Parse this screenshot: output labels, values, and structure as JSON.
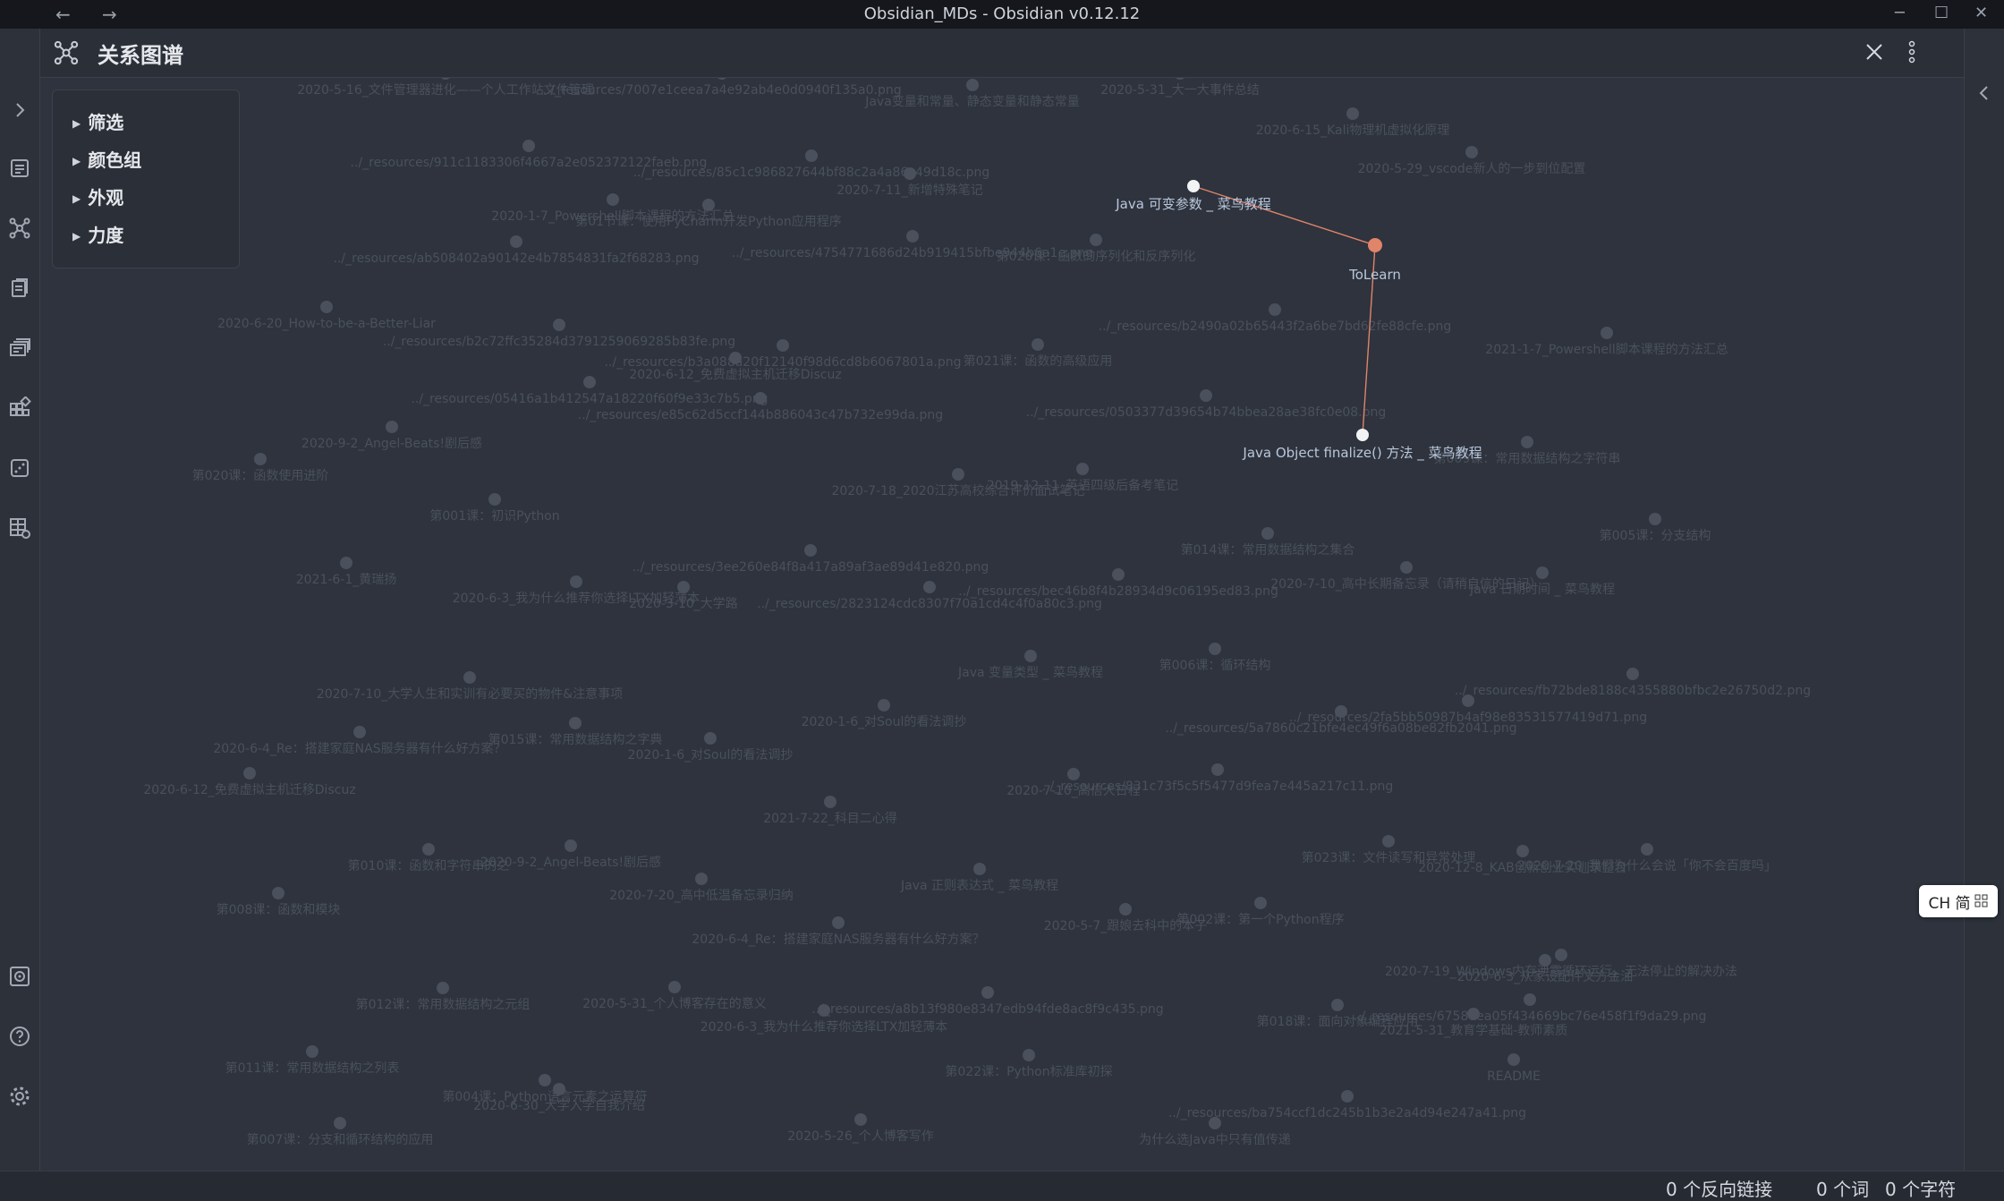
{
  "window": {
    "title": "Obsidian_MDs - Obsidian v0.12.12",
    "back": "←",
    "forward": "→",
    "minimize": "─",
    "maximize": "☐",
    "close": "✕"
  },
  "header": {
    "title": "关系图谱"
  },
  "panel": {
    "items": [
      "筛选",
      "颜色组",
      "外观",
      "力度"
    ]
  },
  "graph": {
    "highlighted": [
      {
        "label": "Java 可变参数 _ 菜鸟教程",
        "kind": "note"
      },
      {
        "label": "ToLearn",
        "kind": "hub"
      },
      {
        "label": "Java Object finalize() 方法 _ 菜鸟教程",
        "kind": "note"
      }
    ],
    "faded_nodes": [
      "2020-5-16_文件管理器进化——个人工作站文件管理",
      "../_resources/7007e1ceea7a4e92ab4e0d0940f135a0.png",
      "Java变量和常量、静态变量和静态常量",
      "2020-5-31_大一大事件总结",
      "2020-6-15_Kali物理机虚拟化原理",
      "2020-5-29_vscode新人的一步到位配置",
      "../_resources/911c1183306f4667a2e052372122faeb.png",
      "../_resources/85c1c986827644bf88c2a4a86c49d18c.png",
      "2020-7-11_新增特殊笔记",
      "2020-1-7_Powershell脚本课程的方法汇总",
      "第01节课：使用PyCharm开发Python应用程序",
      "../_resources/ab508402a90142e4b7854831fa2f68283.png",
      "../_resources/4754771686d24b919415bfbe944b6a1e.png",
      "第020课：函数的序列化和反序列化",
      "2020-6-20_How-to-be-a-Better-Liar",
      "../_resources/b2c72ffc35284d3791259069285b83fe.png",
      "../_resources/b3a088a20f12140f98d6cd8b6067801a.png",
      "2020-6-12_免费虚拟主机迁移Discuz",
      "第021课：函数的高级应用",
      "../_resources/b2490a02b65443f2a6be7bd62fe88cfe.png",
      "2021-1-7_Powershell脚本课程的方法汇总",
      "../_resources/05416a1b412547a18220f60f9e33c7b5.png",
      "../_resources/e85c62d5ccf144b886043c47b732e99da.png",
      "../_resources/0503377d39654b74bbea28ae38fc0e08.png",
      "2020-9-2_Angel-Beats!剧后感",
      "第020课：函数使用进阶",
      "2020-7-18_2020江苏高校综合评价面试笔记",
      "2019-12-11_英语四级后备考笔记",
      "第009课：常用数据结构之字符串",
      "第001课：初识Python",
      "第005课：分支结构",
      "第014课：常用数据结构之集合",
      "../_resources/3ee260e84f8a417a89af3ae89d41e820.png",
      "2020-7-10_高中长期备忘录（请稍自信的日记）",
      "Java 日期时间 _ 菜鸟教程",
      "2021-6-1_黄瑞扬",
      "2020-6-3_我为什么推荐你选择LTX加轻薄本",
      "2020-3-10_大学路",
      "../_resources/2823124cdc8307f70a1cd4c4f0a80c3.png",
      "../_resources/bec46b8f4b28934d9c06195ed83.png",
      "Java 变量类型 _ 菜鸟教程",
      "第006课：循环结构",
      "../_resources/fb72bde8188c4355880bfbc2e26750d2.png",
      "2020-7-10_大学人生和实训有必要买的物件&注意事项",
      "2020-1-6_对Soul的看法调抄",
      "../_resources/5a7860c21bfe4ec49f6a08be82fb2041.png",
      "../_resources/2fa5bb50987b4af98e83531577419d71.png",
      "2020-6-4_Re：搭建家庭NAS服务器有什么好方案？",
      "第015课：常用数据结构之字典",
      "2020-1-6_对Soul的看法调抄",
      "2020-6-12_免费虚拟主机迁移Discuz",
      "2020-7-10_高信大日程",
      "../_resources/831c73f5c5f5477d9fea7e445a217c11.png",
      "2021-7-22_科目二心得",
      "2020-12-8_KAB创新创业实训录整合",
      "2020-7-20_我们为什么会说「你不会百度吗」",
      "第010课：函数和字符串的之",
      "2020-9-2_Angel-Beats!剧后感",
      "第023课：文件读写和异常处理",
      "第008课：函数和模块",
      "2020-7-20_高中低温备忘录归纳",
      "Java 正则表达式 _ 菜鸟教程",
      "2020-5-7_跟娘去科中的本子",
      "第002课：第一个Python程序",
      "2020-6-4_Re：搭建家庭NAS服务器有什么好方案？",
      "2020-6-3_从家设配件文方金油",
      "2020-7-19_Windows内存泄露循环运行，无法停止的解决办法",
      "第012课：常用数据结构之元组",
      "2020-5-31_个人博客存在的意义",
      "../_resources/a8b13f980e8347edb94fde8ac8f9c435.png",
      "../_resources/6758dea05f434669bc76e458f1f9da29.png",
      "第018课：面向对象编程应用",
      "2020-6-3_我为什么推荐你选择LTX加轻薄本",
      "2021-5-31_教育学基础-教师素质",
      "第011课：常用数据结构之列表",
      "第004课：Python语言元素之运算符",
      "第022课：Python标准库初探",
      "第007课：分支和循环结构的应用",
      "2020-6-30_大学入学自我介绍",
      "2020-5-26_个人博客写作",
      "为什么选Java中只有值传递",
      "README",
      "../_resources/ba754ccf1dc245b1b3e2a4d94e247a41.png"
    ]
  },
  "ime": {
    "label": "CH 简"
  },
  "status": {
    "backlinks": "0 个反向链接",
    "words": "0 个词",
    "chars": "0 个字符"
  },
  "colors": {
    "accent": "#e0846a",
    "bg": "#2e333d",
    "node_faded": "#4a505c",
    "label_faded": "#4a515c",
    "highlight_text": "#b9c7dc"
  }
}
